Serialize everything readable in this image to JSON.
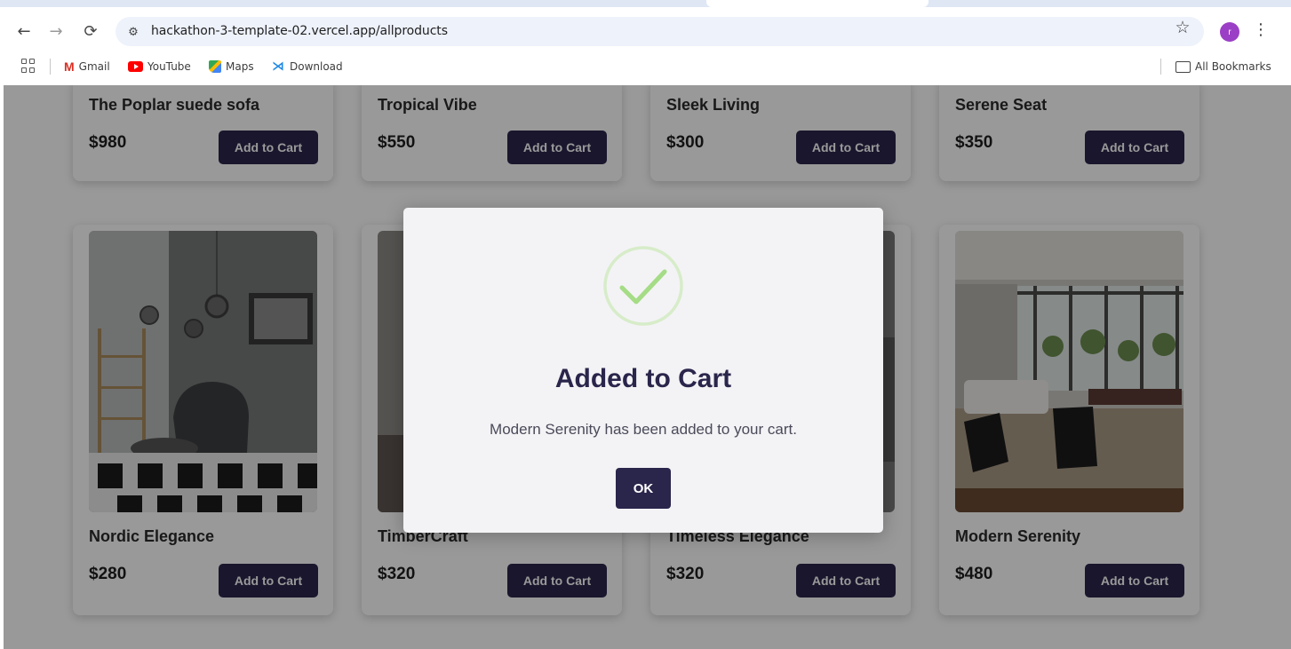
{
  "browser": {
    "url": "hackathon-3-template-02.vercel.app/allproducts",
    "profile_initial": "r",
    "bookmarks": [
      {
        "label": "Gmail",
        "icon": "gmail-icon"
      },
      {
        "label": "YouTube",
        "icon": "youtube-icon"
      },
      {
        "label": "Maps",
        "icon": "maps-icon"
      },
      {
        "label": "Download",
        "icon": "vscode-icon"
      }
    ],
    "all_bookmarks_label": "All Bookmarks"
  },
  "products_top": [
    {
      "name": "The Poplar suede sofa",
      "price": "$980",
      "button": "Add to Cart"
    },
    {
      "name": "Tropical Vibe",
      "price": "$550",
      "button": "Add to Cart"
    },
    {
      "name": "Sleek Living",
      "price": "$300",
      "button": "Add to Cart"
    },
    {
      "name": "Serene Seat",
      "price": "$350",
      "button": "Add to Cart"
    }
  ],
  "products_bottom": [
    {
      "name": "Nordic Elegance",
      "price": "$280",
      "button": "Add to Cart"
    },
    {
      "name": "TimberCraft",
      "price": "$320",
      "button": "Add to Cart"
    },
    {
      "name": "Timeless Elegance",
      "price": "$320",
      "button": "Add to Cart"
    },
    {
      "name": "Modern Serenity",
      "price": "$480",
      "button": "Add to Cart"
    }
  ],
  "modal": {
    "title": "Added to Cart",
    "message": "Modern Serenity has been added to your cart.",
    "ok_label": "OK"
  },
  "colors": {
    "button_bg": "#2a254b",
    "check_green": "#a5dc86",
    "overlay": "rgba(0,0,0,0.40)"
  }
}
